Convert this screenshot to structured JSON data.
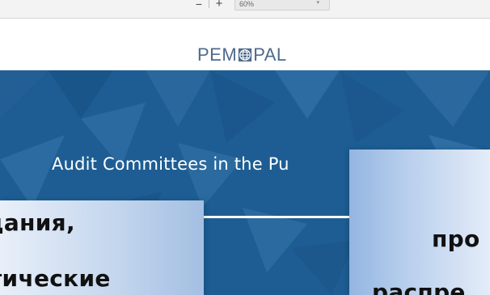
{
  "toolbar": {
    "zoom_out_label": "−",
    "zoom_in_label": "+",
    "zoom_value": "60%",
    "zoom_caret": "▾"
  },
  "document": {
    "logo_left": "PEM",
    "logo_right": "PAL",
    "banner_title": "Audit Committees in the Pu"
  },
  "overlay": {
    "left_line1": "дания,",
    "left_line2": "тические",
    "right_line1": "про",
    "right_line2": "распре"
  },
  "colors": {
    "banner": "#1d5d93",
    "logo": "#4e6a8c"
  },
  "icons": [
    "globe-icon"
  ]
}
